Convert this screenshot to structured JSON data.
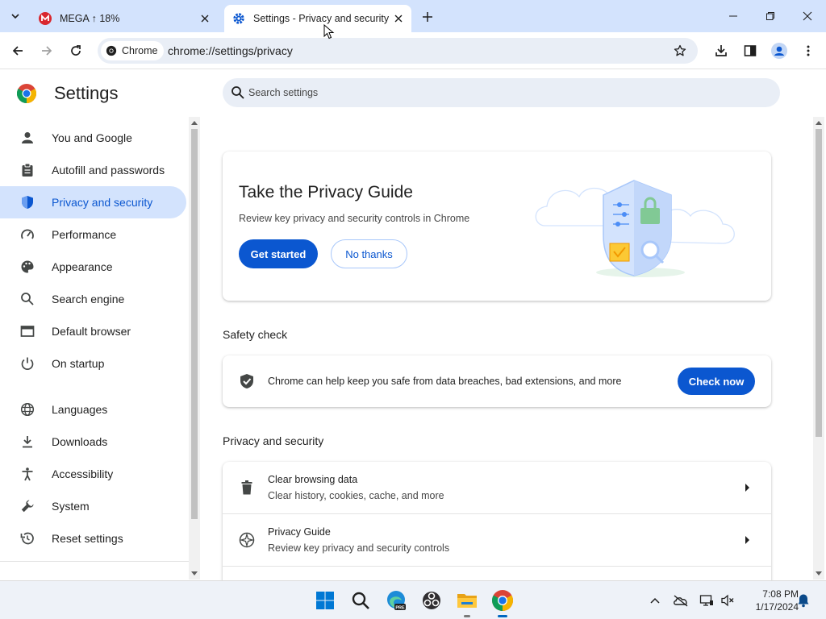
{
  "colors": {
    "accent": "#0b57d0",
    "tab_bar": "#d3e3fd",
    "active_nav_bg": "#d3e3fd"
  },
  "tabs": [
    {
      "title": "MEGA ↑ 18%",
      "icon": "mega-icon",
      "active": false
    },
    {
      "title": "Settings - Privacy and security",
      "icon": "gear-icon",
      "active": true
    }
  ],
  "omnibox": {
    "chip_label": "Chrome",
    "url": "chrome://settings/privacy"
  },
  "settings": {
    "title": "Settings",
    "search_placeholder": "Search settings"
  },
  "sidebar": {
    "items": [
      {
        "label": "You and Google",
        "icon": "person-icon"
      },
      {
        "label": "Autofill and passwords",
        "icon": "clipboard-icon"
      },
      {
        "label": "Privacy and security",
        "icon": "shield-icon",
        "active": true
      },
      {
        "label": "Performance",
        "icon": "speedometer-icon"
      },
      {
        "label": "Appearance",
        "icon": "palette-icon"
      },
      {
        "label": "Search engine",
        "icon": "search-icon"
      },
      {
        "label": "Default browser",
        "icon": "browser-window-icon"
      },
      {
        "label": "On startup",
        "icon": "power-icon"
      },
      {
        "label": "Languages",
        "icon": "globe-icon"
      },
      {
        "label": "Downloads",
        "icon": "download-icon"
      },
      {
        "label": "Accessibility",
        "icon": "accessibility-icon"
      },
      {
        "label": "System",
        "icon": "wrench-icon"
      },
      {
        "label": "Reset settings",
        "icon": "history-icon"
      }
    ]
  },
  "privacy_guide": {
    "title": "Take the Privacy Guide",
    "description": "Review key privacy and security controls in Chrome",
    "primary_button": "Get started",
    "secondary_button": "No thanks"
  },
  "safety_check": {
    "heading": "Safety check",
    "text": "Chrome can help keep you safe from data breaches, bad extensions, and more",
    "button": "Check now"
  },
  "privacy_section": {
    "heading": "Privacy and security",
    "rows": [
      {
        "title": "Clear browsing data",
        "subtitle": "Clear history, cookies, cache, and more",
        "icon": "trash-icon"
      },
      {
        "title": "Privacy Guide",
        "subtitle": "Review key privacy and security controls",
        "icon": "compass-icon"
      }
    ]
  },
  "taskbar": {
    "time": "7:08 PM",
    "date": "1/17/2024",
    "apps": [
      "windows-start-icon",
      "search-icon",
      "edge-beta-icon",
      "obs-icon",
      "file-explorer-icon",
      "chrome-icon"
    ]
  }
}
